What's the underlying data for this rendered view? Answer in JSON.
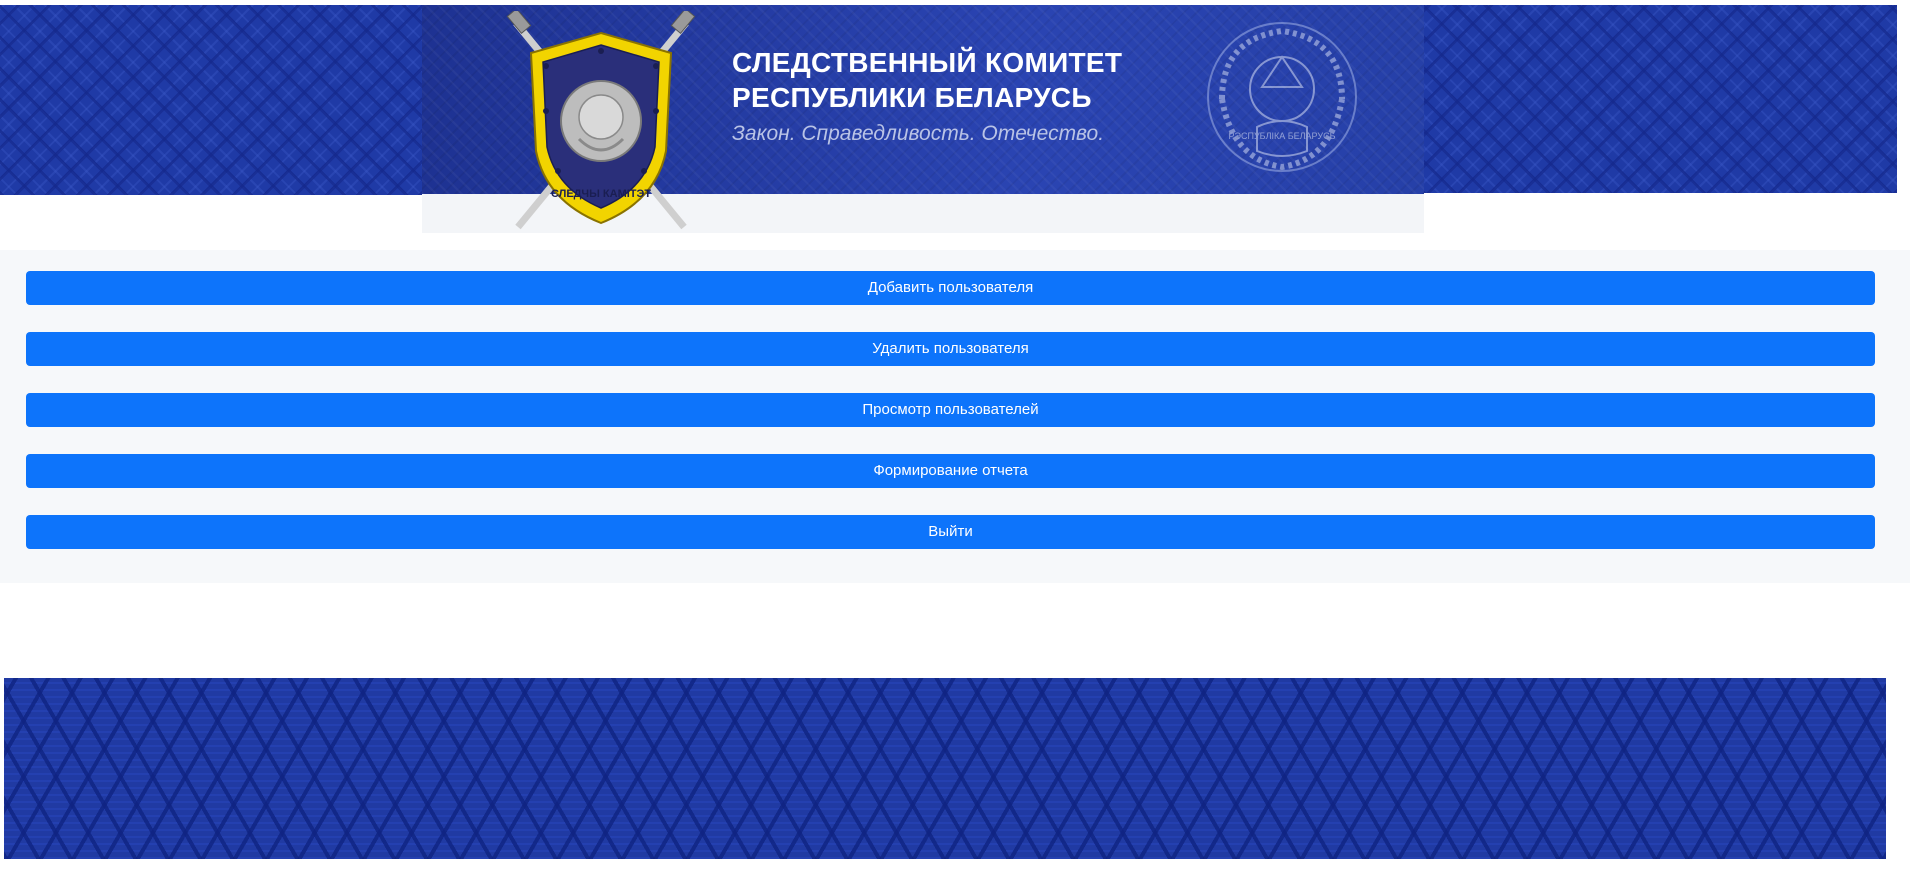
{
  "header": {
    "title_line1": "СЛЕДСТВЕННЫЙ КОМИТЕТ",
    "title_line2": "РЕСПУБЛИКИ БЕЛАРУСЬ",
    "motto": "Закон. Справедливость. Отечество.",
    "emblem_text": "СЛЕДЧЫ КАМІТЭТ",
    "state_emblem_text": "РЭСПУБЛІКА БЕЛАРУСЬ",
    "emblem_icon": "investigative-committee-emblem-icon",
    "state_emblem_icon": "belarus-state-emblem-icon"
  },
  "menu": {
    "buttons": [
      "Добавить пользователя",
      "Удалить пользователя",
      "Просмотр пользователей",
      "Формирование отчета",
      "Выйти"
    ]
  },
  "colors": {
    "button": "#0d74fb",
    "banner": "#23389c",
    "ornament": "#1f3aa6",
    "emblem_gold": "#f2d400"
  }
}
